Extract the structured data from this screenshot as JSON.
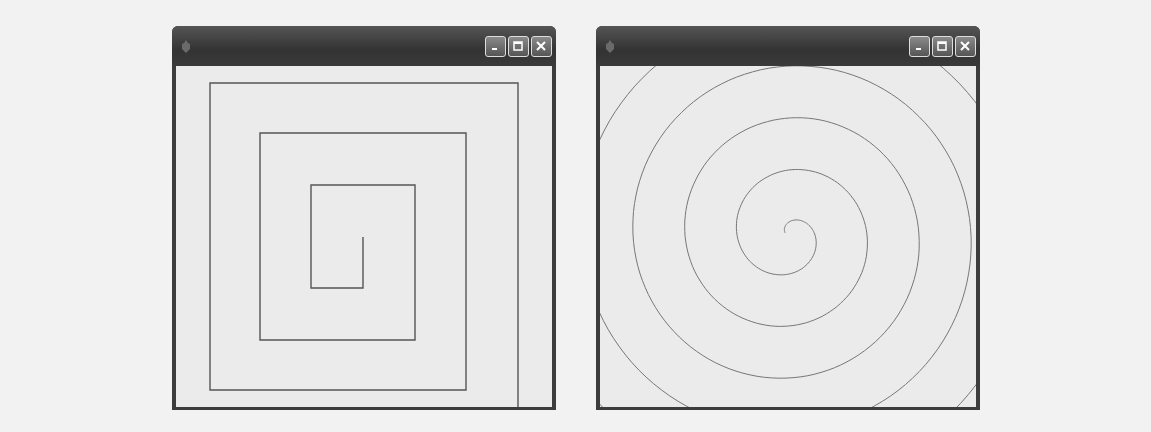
{
  "windows": [
    {
      "kind": "square-spiral"
    },
    {
      "kind": "round-spiral"
    }
  ]
}
